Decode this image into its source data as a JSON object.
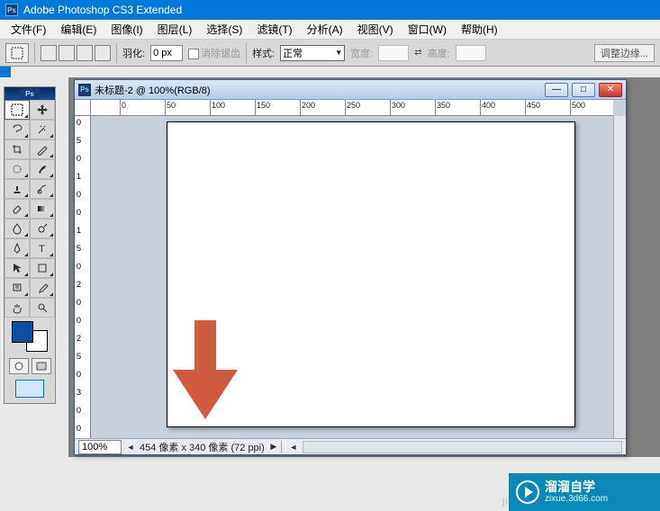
{
  "app": {
    "title": "Adobe Photoshop CS3 Extended",
    "logo": "Ps"
  },
  "menu": {
    "file": "文件(F)",
    "edit": "编辑(E)",
    "image": "图像(I)",
    "layer": "图层(L)",
    "select": "选择(S)",
    "filter": "滤镜(T)",
    "analysis": "分析(A)",
    "view": "视图(V)",
    "window": "窗口(W)",
    "help": "帮助(H)"
  },
  "options": {
    "feather_label": "羽化:",
    "feather_value": "0 px",
    "antialias": "消除锯齿",
    "style_label": "样式:",
    "style_value": "正常",
    "width_label": "宽度:",
    "height_label": "高度:",
    "refine_edge": "调整边缘..."
  },
  "toolbox": {
    "logo": "Ps"
  },
  "colors": {
    "fg": "#0b4ea2",
    "bg": "#ffffff"
  },
  "document": {
    "title": "未标题-2 @ 100%(RGB/8)",
    "zoom": "100%",
    "info": "454 像素 x 340 像素 (72 ppi)",
    "ruler_h": [
      "50",
      "0",
      "50",
      "100",
      "150",
      "200",
      "250",
      "300",
      "350",
      "400",
      "450",
      "500"
    ],
    "ruler_v": [
      "0",
      "5",
      "0",
      "1",
      "0",
      "0",
      "1",
      "5",
      "0",
      "2",
      "0",
      "0",
      "2",
      "5",
      "0",
      "3",
      "0",
      "0"
    ]
  },
  "winbuttons": {
    "min": "—",
    "max": "□",
    "close": "✕"
  },
  "watermark": {
    "side": "ji",
    "main": "溜溜自学",
    "sub": "zixue.3d66.com"
  }
}
